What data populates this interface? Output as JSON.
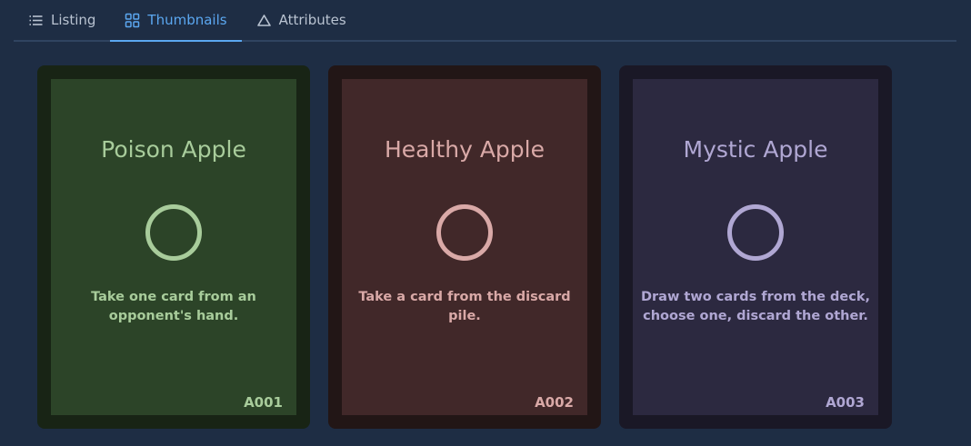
{
  "tabs": [
    {
      "label": "Listing",
      "icon": "list-icon",
      "active": false
    },
    {
      "label": "Thumbnails",
      "icon": "grid-icon",
      "active": true
    },
    {
      "label": "Attributes",
      "icon": "triangle-icon",
      "active": false
    }
  ],
  "colors": {
    "page_background": "#1e2d44",
    "active_tab": "#5ba7f0",
    "inactive_tab": "#b9c3d1"
  },
  "cards": [
    {
      "title": "Poison Apple",
      "description": "Take one card from an opponent's hand.",
      "code": "A001",
      "icon": "ring-icon",
      "accent": "#a8cc9b",
      "background": "#2c4428"
    },
    {
      "title": "Healthy Apple",
      "description": "Take a card from the discard pile.",
      "code": "A002",
      "icon": "ring-icon",
      "accent": "#d9a9a7",
      "background": "#412829"
    },
    {
      "title": "Mystic Apple",
      "description": "Draw two cards from the deck, choose one, discard the other.",
      "code": "A003",
      "icon": "ring-icon",
      "accent": "#b0a7d3",
      "background": "#2c2940"
    }
  ]
}
